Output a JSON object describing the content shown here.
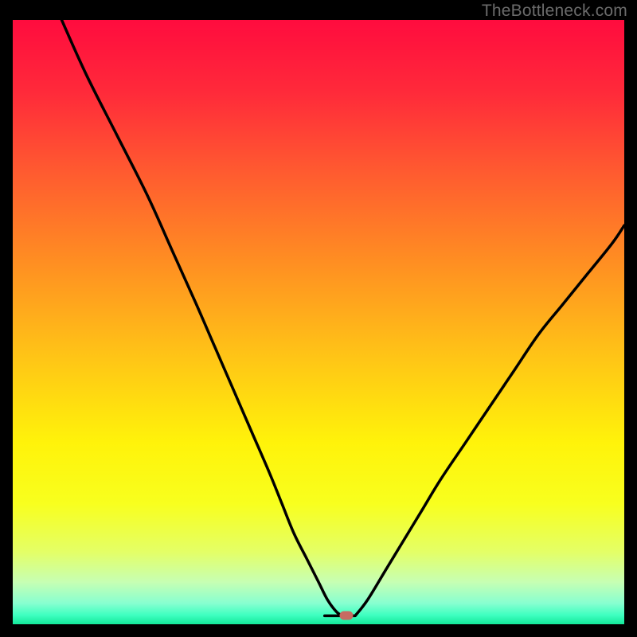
{
  "watermark": "TheBottleneck.com",
  "gradient": {
    "stops": [
      {
        "offset": 0.0,
        "color": "#ff0c3e"
      },
      {
        "offset": 0.12,
        "color": "#ff2a3a"
      },
      {
        "offset": 0.25,
        "color": "#ff5a30"
      },
      {
        "offset": 0.4,
        "color": "#ff8e22"
      },
      {
        "offset": 0.55,
        "color": "#ffc217"
      },
      {
        "offset": 0.7,
        "color": "#fff30a"
      },
      {
        "offset": 0.8,
        "color": "#f8ff1e"
      },
      {
        "offset": 0.88,
        "color": "#e4ff66"
      },
      {
        "offset": 0.93,
        "color": "#c7ffb3"
      },
      {
        "offset": 0.965,
        "color": "#88ffd0"
      },
      {
        "offset": 0.985,
        "color": "#3effc0"
      },
      {
        "offset": 1.0,
        "color": "#13e89a"
      }
    ]
  },
  "marker": {
    "x_frac": 0.545,
    "y_frac": 0.986,
    "color": "#c76b62"
  },
  "chart_data": {
    "type": "line",
    "title": "",
    "xlabel": "",
    "ylabel": "",
    "xlim": [
      0,
      100
    ],
    "ylim": [
      0,
      100
    ],
    "grid": false,
    "legend": false,
    "series": [
      {
        "name": "left-branch",
        "x": [
          8,
          12,
          17,
          22,
          26,
          30,
          33,
          36,
          39,
          42,
          44,
          46,
          48,
          50,
          51.5,
          53,
          54
        ],
        "y": [
          100,
          91,
          81,
          71,
          62,
          53,
          46,
          39,
          32,
          25,
          20,
          15,
          11,
          7,
          4,
          2,
          1.4
        ]
      },
      {
        "name": "right-branch",
        "x": [
          56,
          58,
          61,
          64,
          67,
          70,
          74,
          78,
          82,
          86,
          90,
          94,
          98,
          100
        ],
        "y": [
          1.4,
          4,
          9,
          14,
          19,
          24,
          30,
          36,
          42,
          48,
          53,
          58,
          63,
          66
        ]
      },
      {
        "name": "flat-bottom",
        "x": [
          51,
          56
        ],
        "y": [
          1.4,
          1.4
        ]
      }
    ],
    "annotations": [
      {
        "text": "TheBottleneck.com",
        "pos": "top-right"
      }
    ],
    "optimum_marker": {
      "x": 54.5,
      "y": 1.4
    }
  }
}
